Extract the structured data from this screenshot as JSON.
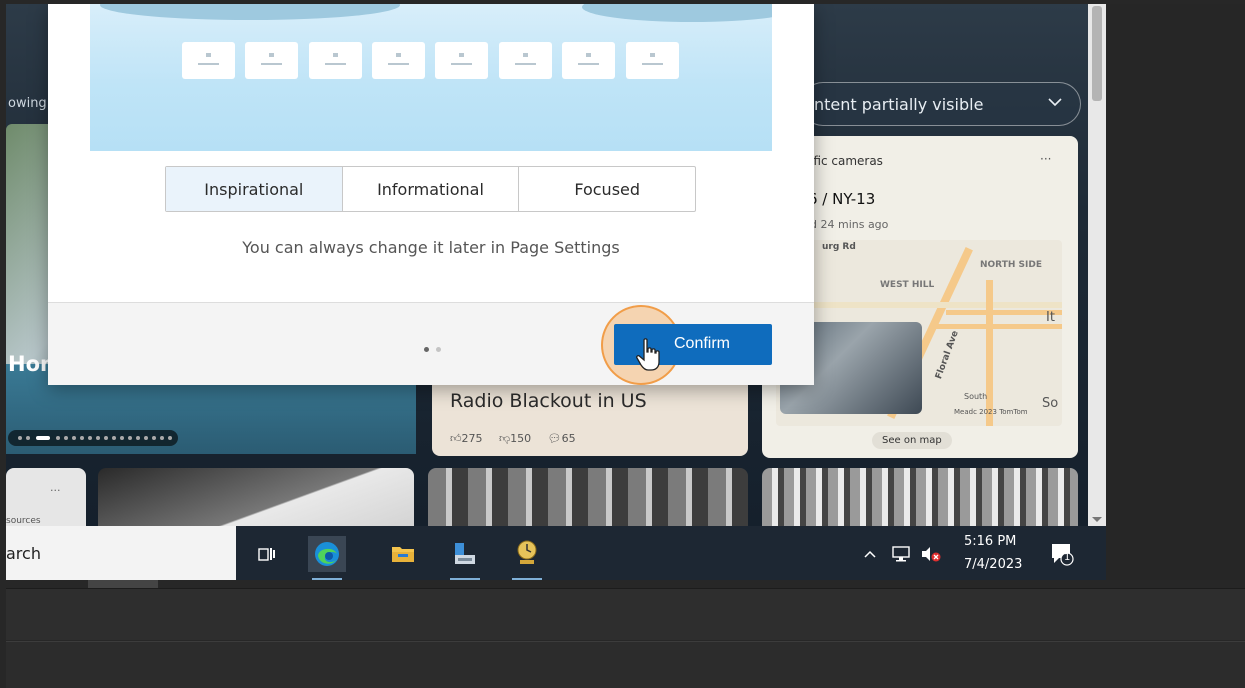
{
  "background_page": {
    "left_partial_text": "owing",
    "hero_partial_title": "Hom",
    "filter_label": "ntent partially visible",
    "traffic_card": {
      "section": "affic cameras",
      "more": "···",
      "route": "6 / NY-13",
      "updated": "d 24 mins ago",
      "map_labels": [
        "urg Rd",
        "WEST HILL",
        "NORTH SIDE",
        "Floral Ave",
        "It",
        "So",
        "South",
        "Meadc 2023 TomTom"
      ],
      "see_on_map": "See on map"
    },
    "news_card": {
      "title": "Radio Blackout in US",
      "likes": "275",
      "dislikes": "150",
      "comments": "65"
    },
    "tile_a": {
      "more": "···",
      "source": "sources"
    }
  },
  "dialog": {
    "tabs": [
      {
        "label": "Inspirational",
        "active": true
      },
      {
        "label": "Informational",
        "active": false
      },
      {
        "label": "Focused",
        "active": false
      }
    ],
    "hint": "You can always change it later in Page Settings",
    "pager": {
      "pages": 2,
      "current": 1
    },
    "confirm_label": "Confirm"
  },
  "taskbar": {
    "search_text": "arch",
    "time": "5:16 PM",
    "date": "7/4/2023",
    "notification_count": "1",
    "apps": [
      "task-view-icon",
      "edge-icon",
      "file-explorer-icon",
      "remote-app-icon",
      "clock-app-icon"
    ],
    "tray": [
      "chevron-up-icon",
      "network-icon",
      "volume-muted-icon"
    ]
  },
  "colors": {
    "accent": "#0f6cbd",
    "active_tab": "#eaf3fb",
    "click_highlight": "#f5a654",
    "taskbar": "#1d2733"
  }
}
